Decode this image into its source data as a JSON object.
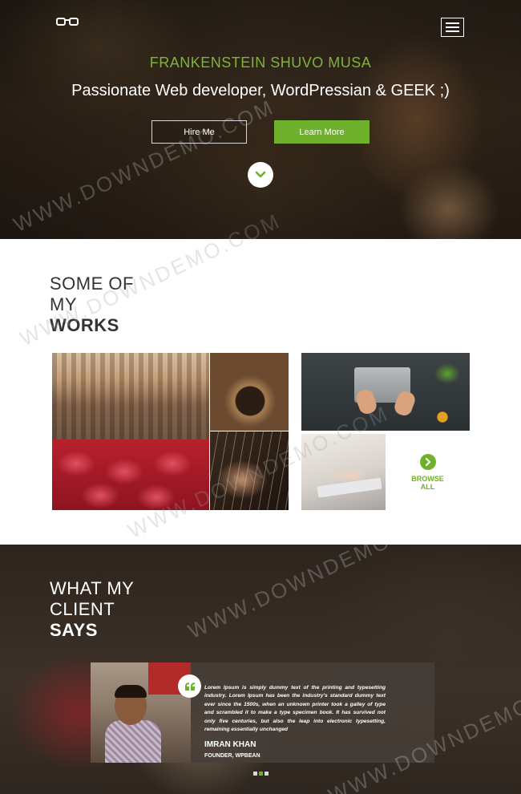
{
  "hero": {
    "logo_icon": "glasses-icon",
    "menu_icon": "hamburger-icon",
    "name": "FRANKENSTEIN SHUVO MUSA",
    "tagline": "Passionate Web developer, WordPressian & GEEK ;)",
    "buttons": {
      "hire": "Hire Me",
      "learn": "Learn More"
    },
    "scroll_icon": "chevron-down-icon"
  },
  "works": {
    "title_line1": "SOME OF",
    "title_line2": "MY",
    "title_line3": "WORKS",
    "browse_icon": "arrow-right-circle-icon",
    "browse_line1": "BROWSE",
    "browse_line2": "ALL"
  },
  "clients": {
    "title_line1": "WHAT MY",
    "title_line2": "CLIENT",
    "title_line3": "SAYS",
    "quote_icon": "quote-icon",
    "quote": "Lorem Ipsum is simply dummy text of the printing and typesetting industry. Lorem Ipsum has been the industry's standard dummy text ever since the 1500s, when an unknown printer took a galley of type and scrambled it to make a type specimen book. It has survived not only five centuries, but also the leap into electronic typesetting, remaining essentially unchanged",
    "name": "IMRAN KHAN",
    "role": "FOUNDER, WPBEAN",
    "active_slide": 2,
    "slide_count": 3
  },
  "watermark": "WWW.DOWNDEMO.COM",
  "colors": {
    "accent": "#6fb02c",
    "name_green": "#7fb33a"
  }
}
